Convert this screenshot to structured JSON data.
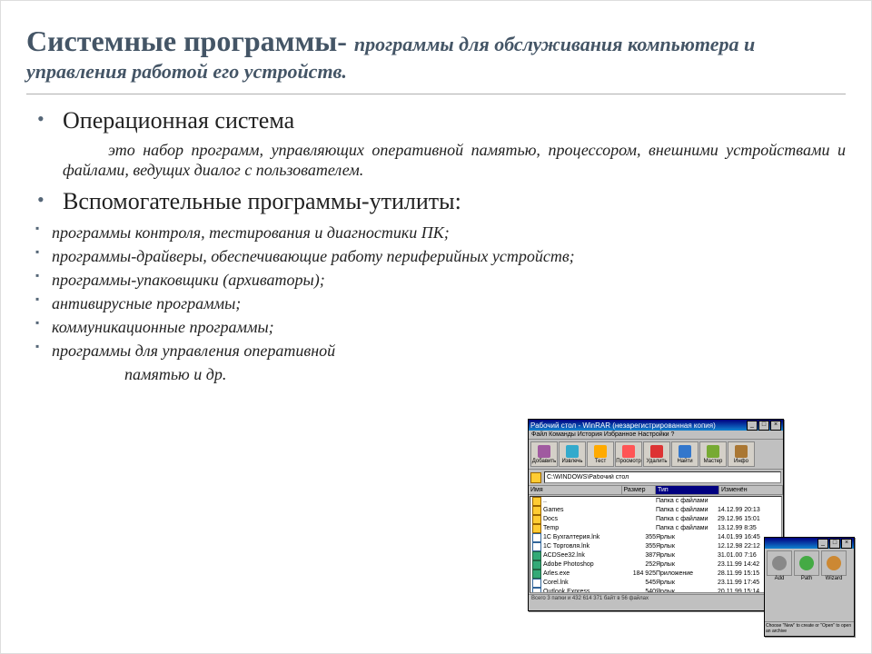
{
  "title": {
    "main": "Системные программы- ",
    "sub": "программы для обслуживания компьютера и управления работой его устройств."
  },
  "section1": {
    "heading": "Операционная система",
    "desc_prefix": "это набор программ, управляющих оперативной памятью, процессором, внешними устройствами и файлами, ведущих диалог с пользователем."
  },
  "section2": {
    "heading": "Вспомогательные программы-утилиты:",
    "items": [
      "программы контроля, тестирования и диагностики ПК;",
      "программы-драйверы, обеспечивающие работу периферийных устройств;",
      "программы-упаковщики (архиваторы);",
      "антивирусные программы;",
      "коммуникационные программы;",
      "программы для управления оперативной"
    ],
    "tail": "памятью и др."
  },
  "winrar": {
    "title": "Рабочий стол - WinRAR (незарегистрированная копия)",
    "menu": "Файл  Команды  История  Избранное  Настройки  ?",
    "toolbar": [
      {
        "label": "Добавить",
        "color": "#a05aa0"
      },
      {
        "label": "Извлечь",
        "color": "#33aacc"
      },
      {
        "label": "Тест",
        "color": "#ffaa00"
      },
      {
        "label": "Просмотр",
        "color": "#ff5555"
      },
      {
        "label": "Удалить",
        "color": "#dd3333"
      },
      {
        "label": "Найти",
        "color": "#3377cc"
      },
      {
        "label": "Мастер",
        "color": "#77aa33"
      },
      {
        "label": "Инфо",
        "color": "#aa7733"
      }
    ],
    "path": "C:\\WINDOWS\\Рабочий стол",
    "columns": {
      "c1": "Имя",
      "c2": "Размер",
      "c3": "Тип",
      "c4": "Изменён"
    },
    "rows": [
      {
        "ic": "fold",
        "name": "..",
        "size": "",
        "type": "Папка с файлами",
        "date": ""
      },
      {
        "ic": "fold",
        "name": "Games",
        "size": "",
        "type": "Папка с файлами",
        "date": "14.12.99 20:13"
      },
      {
        "ic": "fold",
        "name": "Docs",
        "size": "",
        "type": "Папка с файлами",
        "date": "29.12.96 15:01"
      },
      {
        "ic": "fold",
        "name": "Temp",
        "size": "",
        "type": "Папка с файлами",
        "date": "13.12.99 8:35"
      },
      {
        "ic": "doc",
        "name": "1С Бухгалтерия.lnk",
        "size": "355",
        "type": "Ярлык",
        "date": "14.01.99 16:45"
      },
      {
        "ic": "doc",
        "name": "1С Торговля.lnk",
        "size": "355",
        "type": "Ярлык",
        "date": "12.12.98 22:12"
      },
      {
        "ic": "app",
        "name": "ACDSee32.lnk",
        "size": "387",
        "type": "Ярлык",
        "date": "31.01.00 7:16"
      },
      {
        "ic": "app",
        "name": "Adobe Photoshop",
        "size": "252",
        "type": "Ярлык",
        "date": "23.11.99 14:42"
      },
      {
        "ic": "app",
        "name": "Arles.exe",
        "size": "184 925",
        "type": "Приложение",
        "date": "28.11.99 15:15"
      },
      {
        "ic": "doc",
        "name": "Corel.lnk",
        "size": "545",
        "type": "Ярлык",
        "date": "23.11.99 17:45"
      },
      {
        "ic": "doc",
        "name": "Outlook Express",
        "size": "540",
        "type": "Ярлык",
        "date": "20.11.99 15:14"
      }
    ],
    "status": "Всего 3 папки и 432 614 371 байт в 56 файлах"
  },
  "smallwin": {
    "icons": [
      {
        "label": "Add",
        "color": "#888"
      },
      {
        "label": "Path",
        "color": "#44aa44"
      },
      {
        "label": "Wizard",
        "color": "#cc8833"
      }
    ],
    "status": "Choose \"New\" to create or \"Open\" to open an archive"
  }
}
